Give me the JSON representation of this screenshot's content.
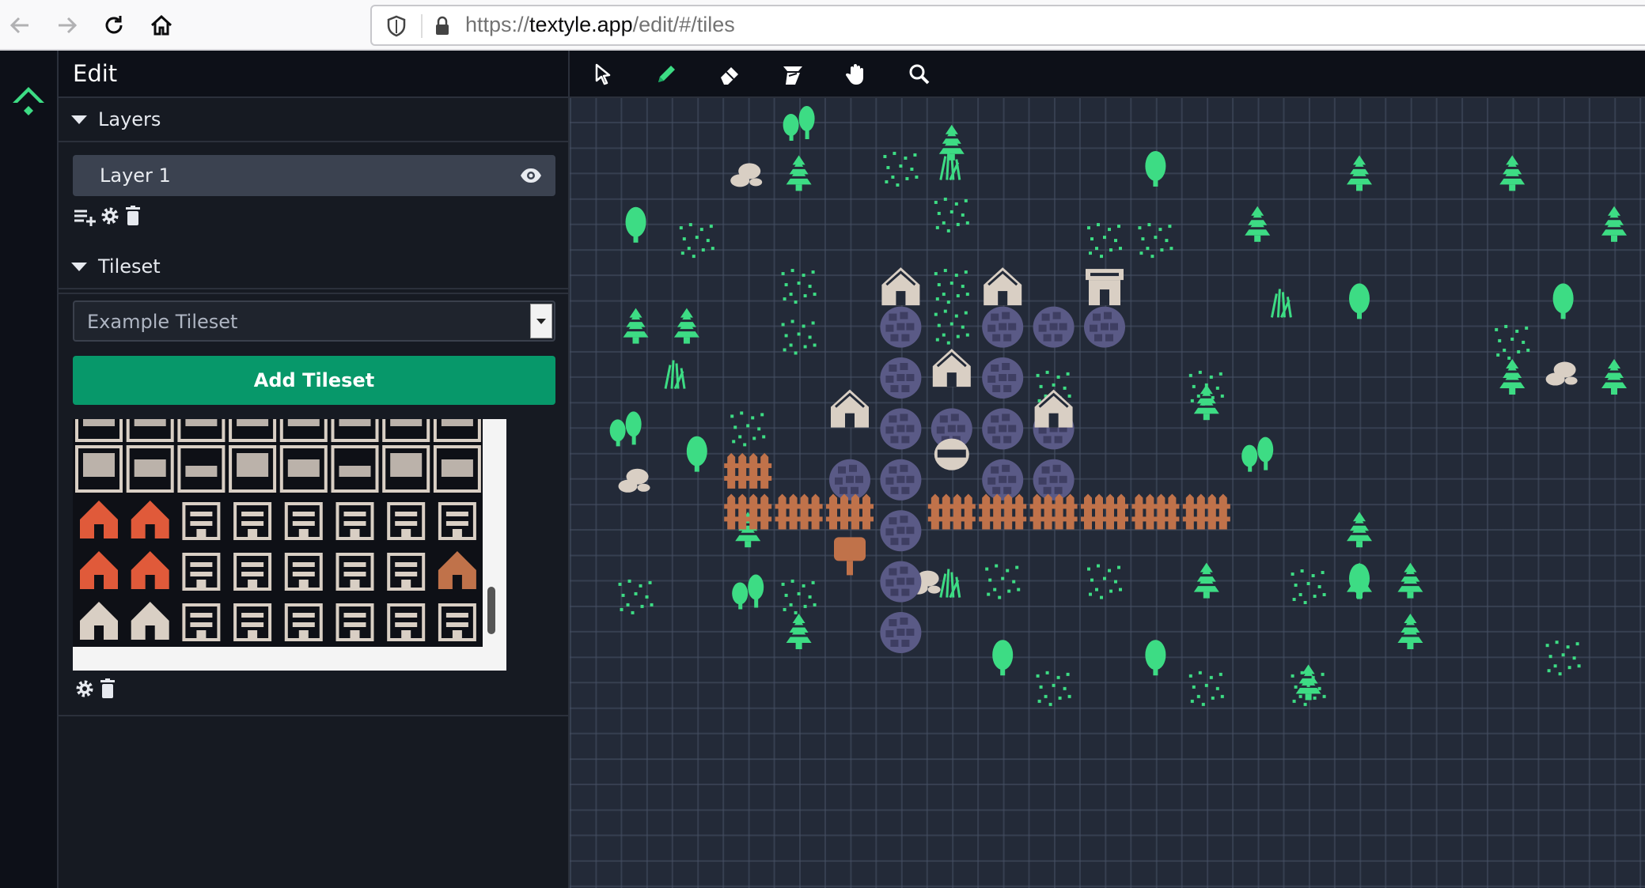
{
  "browser": {
    "url_scheme": "https://",
    "url_host": "textyle.app",
    "url_path": "/edit/#/tiles"
  },
  "sidebar": {
    "title": "Edit",
    "layers": {
      "heading": "Layers",
      "items": [
        {
          "label": "Layer 1",
          "visible": true
        }
      ]
    },
    "tileset": {
      "heading": "Tileset",
      "selected": "Example Tileset",
      "add_button": "Add Tileset"
    }
  },
  "toolbar": {
    "tools": [
      "select-icon",
      "pencil-icon",
      "eraser-icon",
      "fill-icon",
      "hand-icon",
      "zoom-icon"
    ]
  },
  "colors": {
    "accent": "#07986a",
    "tree": "#3ddc84",
    "fence": "#c0724a",
    "stone": "#5a5a86",
    "house": "#d9cfc4",
    "canvas": "#232a38"
  }
}
